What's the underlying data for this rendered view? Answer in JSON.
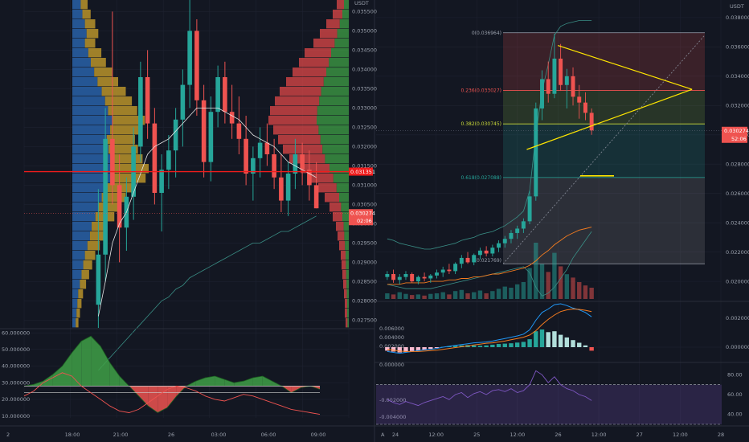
{
  "colors": {
    "bg": "#131722",
    "grid": "#1e2230",
    "up": "#26a69a",
    "down": "#ef5350",
    "red_line": "#f01c1c",
    "yellow": "#ffe600",
    "volume_blue": "#2962a8",
    "volume_gold": "#b8932a",
    "profile_red": "#e04848",
    "profile_green": "#3fa046",
    "white_line": "#e6e6e6",
    "teal_line": "#3a8f86",
    "orange_line": "#f57c1f",
    "macd_blue": "#2196f3",
    "rsi_purple": "#7e57c2"
  },
  "left_panel": {
    "currency": "USDT",
    "price_ticks": [
      "0.035500",
      "0.035000",
      "0.034500",
      "0.034000",
      "0.033500",
      "0.033000",
      "0.032500",
      "0.032000",
      "0.031500",
      "0.031000",
      "0.030500",
      "0.030000",
      "0.029500",
      "0.029000",
      "0.028500",
      "0.028000",
      "0.027500"
    ],
    "current_price_tag": "0.030274",
    "current_price": 0.030274,
    "countdown_tag": "02:06",
    "red_level_tag": "0.031351",
    "red_level": 0.031351,
    "price_range": [
      0.0273,
      0.0358
    ],
    "time_ticks": [
      "18:00",
      "21:00",
      "26",
      "03:00",
      "06:00",
      "09:00"
    ],
    "indicator_ticks": [
      "60.000000",
      "50.000000",
      "40.000000",
      "30.000000",
      "20.000000",
      "10.000000"
    ],
    "indicator_range": [
      5,
      62
    ],
    "indicator_threshold": 28,
    "indicator_reference": 24,
    "pane_label": "2",
    "candles": [
      [
        0.0279,
        0.0309,
        0.0273,
        0.0292
      ],
      [
        0.0292,
        0.033,
        0.0285,
        0.0322
      ],
      [
        0.0322,
        0.0355,
        0.0305,
        0.031
      ],
      [
        0.031,
        0.0318,
        0.029,
        0.0299
      ],
      [
        0.0299,
        0.0312,
        0.0293,
        0.0307
      ],
      [
        0.0307,
        0.0325,
        0.0301,
        0.032
      ],
      [
        0.032,
        0.0342,
        0.0316,
        0.0338
      ],
      [
        0.0338,
        0.0345,
        0.0322,
        0.0326
      ],
      [
        0.0326,
        0.033,
        0.0305,
        0.0308
      ],
      [
        0.0308,
        0.0318,
        0.0298,
        0.0314
      ],
      [
        0.0314,
        0.0323,
        0.0309,
        0.0319
      ],
      [
        0.0319,
        0.033,
        0.0312,
        0.0327
      ],
      [
        0.0327,
        0.034,
        0.032,
        0.0336
      ],
      [
        0.0336,
        0.0358,
        0.033,
        0.035
      ],
      [
        0.035,
        0.0353,
        0.0328,
        0.0332
      ],
      [
        0.0332,
        0.0336,
        0.0312,
        0.0316
      ],
      [
        0.0316,
        0.0333,
        0.0311,
        0.0329
      ],
      [
        0.0329,
        0.0341,
        0.0325,
        0.0338
      ],
      [
        0.0338,
        0.0342,
        0.0326,
        0.0329
      ],
      [
        0.0329,
        0.0336,
        0.0322,
        0.0326
      ],
      [
        0.0326,
        0.0333,
        0.0318,
        0.0322
      ],
      [
        0.0322,
        0.0328,
        0.031,
        0.0313
      ],
      [
        0.0313,
        0.032,
        0.0306,
        0.0317
      ],
      [
        0.0317,
        0.0325,
        0.0312,
        0.0321
      ],
      [
        0.0321,
        0.0326,
        0.0315,
        0.0318
      ],
      [
        0.0318,
        0.0322,
        0.0309,
        0.0312
      ],
      [
        0.0312,
        0.0318,
        0.0303,
        0.0306
      ],
      [
        0.0306,
        0.0316,
        0.0302,
        0.0313
      ],
      [
        0.0313,
        0.0322,
        0.0309,
        0.0318
      ],
      [
        0.0318,
        0.0321,
        0.031,
        0.0314
      ],
      [
        0.0314,
        0.0319,
        0.0306,
        0.031
      ],
      [
        0.031,
        0.0316,
        0.0304,
        0.0304
      ]
    ],
    "ma_white": [
      0.0276,
      0.0285,
      0.0295,
      0.03,
      0.0303,
      0.0308,
      0.0313,
      0.0318,
      0.032,
      0.0321,
      0.0322,
      0.0324,
      0.0326,
      0.0328,
      0.033,
      0.033,
      0.033,
      0.033,
      0.0329,
      0.0328,
      0.0327,
      0.0325,
      0.0323,
      0.0322,
      0.0321,
      0.032,
      0.0318,
      0.0316,
      0.0315,
      0.0314,
      0.0313,
      0.0312
    ],
    "ma_teal": [
      0.0262,
      0.0264,
      0.0266,
      0.0268,
      0.027,
      0.0272,
      0.0274,
      0.0276,
      0.0278,
      0.028,
      0.0281,
      0.0283,
      0.0284,
      0.0286,
      0.0287,
      0.0288,
      0.0289,
      0.029,
      0.0291,
      0.0292,
      0.0293,
      0.0294,
      0.0295,
      0.0295,
      0.0296,
      0.0297,
      0.0298,
      0.0298,
      0.0299,
      0.03,
      0.0301,
      0.0302
    ],
    "volume_profile_left": [
      0.2,
      0.24,
      0.3,
      0.34,
      0.3,
      0.38,
      0.44,
      0.52,
      0.6,
      0.7,
      0.78,
      0.85,
      0.95,
      0.9,
      0.82,
      0.86,
      0.92,
      1.0,
      0.96,
      0.8,
      0.7,
      0.62,
      0.55,
      0.46,
      0.42,
      0.36,
      0.3,
      0.26,
      0.22,
      0.18,
      0.14,
      0.12,
      0.1,
      0.08
    ],
    "volume_profile_right": [
      0.15,
      0.2,
      0.28,
      0.36,
      0.44,
      0.55,
      0.62,
      0.7,
      0.78,
      0.86,
      0.92,
      0.98,
      1.0,
      0.94,
      0.88,
      0.82,
      0.74,
      0.6,
      0.48,
      0.38,
      0.3,
      0.24,
      0.2,
      0.16,
      0.14,
      0.12,
      0.1,
      0.09,
      0.08,
      0.07,
      0.06,
      0.05,
      0.05,
      0.04
    ],
    "indicator_main": [
      28,
      29,
      31,
      35,
      40,
      48,
      55,
      58,
      52,
      42,
      34,
      28,
      22,
      16,
      12,
      15,
      22,
      28,
      31,
      33,
      34,
      32,
      30,
      31,
      33,
      34,
      31,
      28,
      24,
      27,
      28,
      26
    ],
    "indicator_red": [
      22,
      25,
      30,
      33,
      36,
      34,
      28,
      24,
      20,
      16,
      13,
      12,
      14,
      18,
      22,
      26,
      28,
      27,
      25,
      22,
      20,
      19,
      21,
      23,
      22,
      20,
      18,
      16,
      14,
      13,
      12,
      11
    ]
  },
  "right_panel": {
    "currency": "USDT",
    "price_ticks": [
      "0.038000",
      "0.036000",
      "0.034000",
      "0.032000",
      "0.030000",
      "0.028000",
      "0.026000",
      "0.024000",
      "0.022000",
      "0.020000"
    ],
    "price_range": [
      0.0188,
      0.0392
    ],
    "current_price_tag": "0.030274",
    "current_price": 0.030274,
    "countdown_tag": "52:06",
    "fib_levels": [
      {
        "label": "0(0.036964)",
        "value": 0.036964,
        "color": "#9aa0ac"
      },
      {
        "label": "0.236(0.033027)",
        "value": 0.033027,
        "color": "#ef5350"
      },
      {
        "label": "0.382(0.030745)",
        "value": 0.030745,
        "color": "#cddc39"
      },
      {
        "label": "0.618(0.027088)",
        "value": 0.027088,
        "color": "#26a69a"
      }
    ],
    "fib_bottom": 0.0212,
    "fib_bottom_label": "(0.021769)",
    "time_ticks": [
      "24",
      "12:00",
      "25",
      "12:00",
      "26",
      "12:00",
      "27",
      "12:00",
      "28"
    ],
    "macd_ticks": [
      "0.002000",
      "0.000000"
    ],
    "macd_left_ticks": [
      "0.006000",
      "0.004000",
      "0.002000",
      "0.000000",
      "-0.002000",
      "-0.004000"
    ],
    "rsi_ticks": [
      "80.00",
      "60.00",
      "40.00"
    ],
    "pane_label": "A",
    "candles": [
      [
        0.0203,
        0.0207,
        0.0201,
        0.0205
      ],
      [
        0.0205,
        0.0208,
        0.0199,
        0.0201
      ],
      [
        0.0201,
        0.0205,
        0.0198,
        0.0203
      ],
      [
        0.0203,
        0.0207,
        0.0201,
        0.0205
      ],
      [
        0.0205,
        0.0206,
        0.0199,
        0.02
      ],
      [
        0.02,
        0.0204,
        0.0198,
        0.0203
      ],
      [
        0.0203,
        0.0206,
        0.02,
        0.0202
      ],
      [
        0.0202,
        0.0205,
        0.0199,
        0.0204
      ],
      [
        0.0204,
        0.0208,
        0.0202,
        0.0206
      ],
      [
        0.0206,
        0.021,
        0.0203,
        0.0208
      ],
      [
        0.0208,
        0.0212,
        0.0205,
        0.0207
      ],
      [
        0.0207,
        0.0213,
        0.0205,
        0.0212
      ],
      [
        0.0212,
        0.0218,
        0.0209,
        0.0216
      ],
      [
        0.0216,
        0.022,
        0.0212,
        0.0213
      ],
      [
        0.0213,
        0.0219,
        0.0211,
        0.0218
      ],
      [
        0.0218,
        0.0223,
        0.0215,
        0.0221
      ],
      [
        0.0221,
        0.0224,
        0.0217,
        0.0219
      ],
      [
        0.0219,
        0.0225,
        0.0217,
        0.0223
      ],
      [
        0.0223,
        0.0228,
        0.022,
        0.0226
      ],
      [
        0.0226,
        0.0231,
        0.0223,
        0.0229
      ],
      [
        0.0229,
        0.0235,
        0.0226,
        0.0233
      ],
      [
        0.0233,
        0.0238,
        0.0229,
        0.0236
      ],
      [
        0.0236,
        0.0243,
        0.0233,
        0.0241
      ],
      [
        0.0241,
        0.0262,
        0.0239,
        0.0258
      ],
      [
        0.0258,
        0.0322,
        0.0255,
        0.0318
      ],
      [
        0.0318,
        0.0344,
        0.031,
        0.0338
      ],
      [
        0.0338,
        0.035,
        0.0322,
        0.0328
      ],
      [
        0.0328,
        0.0369,
        0.0325,
        0.0352
      ],
      [
        0.0352,
        0.0362,
        0.033,
        0.0334
      ],
      [
        0.0334,
        0.0345,
        0.0318,
        0.034
      ],
      [
        0.034,
        0.0346,
        0.032,
        0.0326
      ],
      [
        0.0326,
        0.0334,
        0.0311,
        0.0322
      ],
      [
        0.0322,
        0.0329,
        0.031,
        0.0315
      ],
      [
        0.0315,
        0.0318,
        0.03,
        0.0303
      ]
    ],
    "triangle": {
      "top": [
        [
          13,
          0.0361
        ],
        [
          20,
          0.0331
        ]
      ],
      "bottom": [
        [
          12,
          0.029
        ],
        [
          20,
          0.0331
        ]
      ]
    },
    "volume": [
      0.1,
      0.08,
      0.12,
      0.09,
      0.07,
      0.08,
      0.06,
      0.09,
      0.1,
      0.12,
      0.08,
      0.14,
      0.16,
      0.1,
      0.12,
      0.15,
      0.1,
      0.14,
      0.18,
      0.22,
      0.2,
      0.26,
      0.3,
      0.55,
      1.0,
      0.62,
      0.48,
      0.82,
      0.58,
      0.44,
      0.38,
      0.3,
      0.24,
      0.2
    ],
    "macd_hist": [
      -0.2,
      -0.25,
      -0.3,
      -0.28,
      -0.22,
      -0.18,
      -0.15,
      -0.1,
      -0.05,
      0.02,
      0.05,
      0.08,
      0.1,
      0.12,
      0.1,
      0.08,
      0.1,
      0.14,
      0.18,
      0.2,
      0.22,
      0.26,
      0.3,
      0.45,
      0.9,
      1.0,
      0.85,
      0.9,
      0.7,
      0.55,
      0.4,
      0.25,
      0.1,
      -0.2
    ],
    "macd_line": [
      -0.1,
      -0.12,
      -0.14,
      -0.12,
      -0.1,
      -0.08,
      -0.06,
      -0.05,
      -0.03,
      0.0,
      0.02,
      0.04,
      0.06,
      0.08,
      0.1,
      0.11,
      0.12,
      0.14,
      0.17,
      0.2,
      0.23,
      0.26,
      0.3,
      0.4,
      0.62,
      0.8,
      0.88,
      0.98,
      1.0,
      0.96,
      0.9,
      0.86,
      0.8,
      0.7
    ],
    "signal_line": [
      -0.05,
      -0.07,
      -0.09,
      -0.1,
      -0.1,
      -0.1,
      -0.09,
      -0.08,
      -0.07,
      -0.05,
      -0.03,
      -0.01,
      0.01,
      0.03,
      0.05,
      0.07,
      0.09,
      0.1,
      0.12,
      0.14,
      0.17,
      0.2,
      0.23,
      0.28,
      0.38,
      0.52,
      0.64,
      0.74,
      0.82,
      0.86,
      0.88,
      0.87,
      0.85,
      0.82
    ],
    "rsi": [
      55,
      52,
      50,
      53,
      51,
      49,
      52,
      54,
      56,
      58,
      55,
      60,
      62,
      57,
      61,
      63,
      60,
      64,
      65,
      63,
      66,
      62,
      64,
      70,
      84,
      80,
      72,
      78,
      70,
      66,
      64,
      60,
      58,
      54
    ],
    "bollinger_upper": [
      0.0229,
      0.0228,
      0.0226,
      0.0225,
      0.0224,
      0.0223,
      0.0222,
      0.0222,
      0.0223,
      0.0224,
      0.0225,
      0.0226,
      0.0228,
      0.0229,
      0.023,
      0.0232,
      0.0233,
      0.0234,
      0.0236,
      0.0238,
      0.0241,
      0.0244,
      0.0248,
      0.0262,
      0.03,
      0.033,
      0.0348,
      0.0368,
      0.0374,
      0.0376,
      0.0377,
      0.0378,
      0.0378,
      0.0378
    ],
    "bollinger_lower": [
      0.0198,
      0.0197,
      0.0196,
      0.0195,
      0.0195,
      0.0195,
      0.0195,
      0.0195,
      0.0196,
      0.0197,
      0.0198,
      0.0199,
      0.02,
      0.0201,
      0.0202,
      0.0203,
      0.0204,
      0.0205,
      0.0206,
      0.0207,
      0.0208,
      0.0209,
      0.021,
      0.0206,
      0.0196,
      0.019,
      0.0192,
      0.0196,
      0.0202,
      0.0208,
      0.0216,
      0.0222,
      0.0228,
      0.0234
    ],
    "ma_orange": [
      0.0198,
      0.0198,
      0.0198,
      0.0199,
      0.0199,
      0.0199,
      0.0199,
      0.02,
      0.02,
      0.02,
      0.0201,
      0.0201,
      0.0202,
      0.0202,
      0.0203,
      0.0203,
      0.0204,
      0.0205,
      0.0205,
      0.0206,
      0.0207,
      0.0208,
      0.0209,
      0.0211,
      0.0214,
      0.0218,
      0.0221,
      0.0225,
      0.0228,
      0.0231,
      0.0233,
      0.0235,
      0.0236,
      0.0237
    ]
  }
}
